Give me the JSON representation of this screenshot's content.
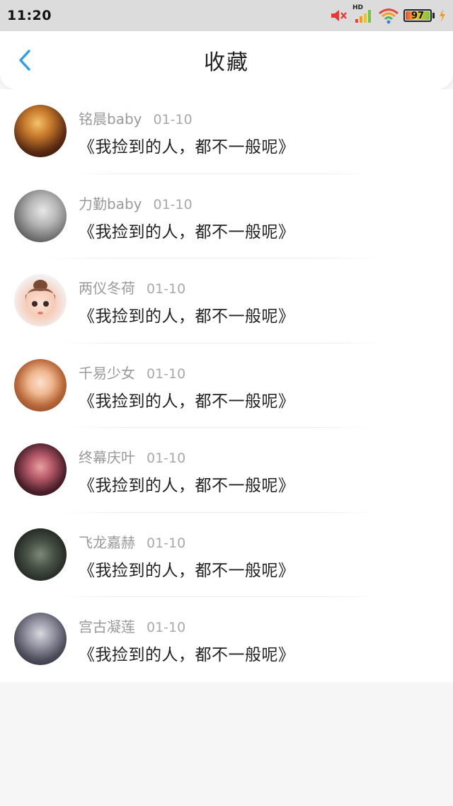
{
  "status_bar": {
    "time": "11:20",
    "network_label": "HD",
    "battery_level": "97",
    "icons": [
      "mute-icon",
      "signal-icon",
      "wifi-icon",
      "battery-icon",
      "charging-icon"
    ]
  },
  "header": {
    "title": "收藏",
    "back_icon": "chevron-left-icon",
    "accent_color": "#2f9de8"
  },
  "favorites": [
    {
      "name": "铭晨baby",
      "date": "01-10",
      "title": "《我捡到的人，都不一般呢》"
    },
    {
      "name": "力勤baby",
      "date": "01-10",
      "title": "《我捡到的人，都不一般呢》"
    },
    {
      "name": "两仪冬荷",
      "date": "01-10",
      "title": "《我捡到的人，都不一般呢》"
    },
    {
      "name": "千易少女",
      "date": "01-10",
      "title": "《我捡到的人，都不一般呢》"
    },
    {
      "name": "终幕庆叶",
      "date": "01-10",
      "title": "《我捡到的人，都不一般呢》"
    },
    {
      "name": "飞龙嘉赫",
      "date": "01-10",
      "title": "《我捡到的人，都不一般呢》"
    },
    {
      "name": "宫古凝莲",
      "date": "01-10",
      "title": "《我捡到的人，都不一般呢》"
    }
  ]
}
